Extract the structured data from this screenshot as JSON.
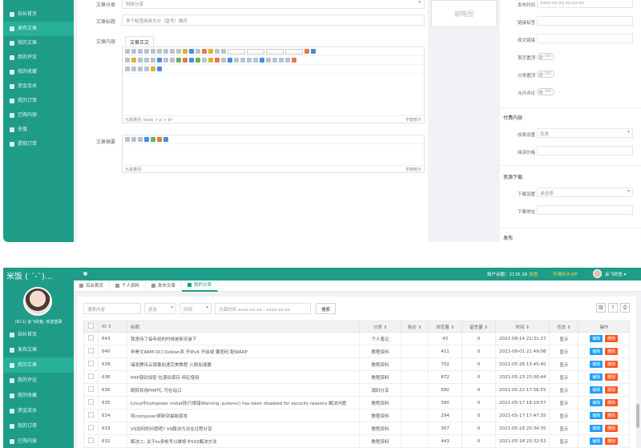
{
  "top": {
    "sidebar": [
      {
        "label": "站长首页",
        "active": false
      },
      {
        "label": "发布文章",
        "active": true
      },
      {
        "label": "我的文章",
        "active": false
      },
      {
        "label": "我的评论",
        "active": false
      },
      {
        "label": "我的收藏",
        "active": false
      },
      {
        "label": "资金流水",
        "active": false
      },
      {
        "label": "我的订单",
        "active": false
      },
      {
        "label": "已购内容",
        "active": false
      },
      {
        "label": "充值",
        "active": false
      },
      {
        "label": "提现订单",
        "active": false
      }
    ],
    "form": {
      "category_label": "文章分类",
      "category_value": "科技分享",
      "title_label": "文章标题",
      "title_value": "多个标签用英文分（逗号）隔开",
      "content_label": "文章内容",
      "tab_label": "文章正文",
      "editor_status_left": "元素路径: body > p > br",
      "editor_status_right": "字数统计",
      "summary_label": "文章摘要",
      "summary_status_left": "元素路径:",
      "summary_status_right": "字数统计"
    },
    "thumb": "缩略图",
    "options": {
      "time_label": "发布时间",
      "time_value": "xxxx-xx-xx xx:xx:xx",
      "tag_label": "链接标签",
      "source_label": "原文链接",
      "top_label": "首页置顶",
      "comment_label": "允许评论",
      "toggles": [
        {
          "label": "首页置顶",
          "value": "OFF"
        },
        {
          "label": "分类置顶",
          "value": "OFF"
        },
        {
          "label": "允许评论",
          "value": "OFF"
        }
      ],
      "section_paid": "付费内容",
      "charge_label": "收费设置",
      "charge_value": "免费",
      "price_label": "阅读价格",
      "section_download": "资源下载",
      "download_label": "下载设置",
      "download_value": "请选择",
      "download_url_label": "下载地址",
      "section_publish": "发布"
    }
  },
  "bottom": {
    "logo": "米饭 ( ´-`)...",
    "balance_text": "账户余额：2135.36",
    "balance_link": "充值",
    "vip_link": "开通永久VIP",
    "username": "会飞的鱼",
    "welcome": "(ID:1) 会飞的鱼, 欢迎登录",
    "sidebar": [
      {
        "label": "站长首页",
        "active": false
      },
      {
        "label": "发布文章",
        "active": false
      },
      {
        "label": "我的文章",
        "active": true
      },
      {
        "label": "我的评论",
        "active": false
      },
      {
        "label": "我的收藏",
        "active": false
      },
      {
        "label": "资金流水",
        "active": false
      },
      {
        "label": "我的订单",
        "active": false
      },
      {
        "label": "已购内容",
        "active": false
      }
    ],
    "tabs": [
      {
        "label": "后台首页",
        "active": false
      },
      {
        "label": "个人资料",
        "active": false
      },
      {
        "label": "发布文章",
        "active": false
      },
      {
        "label": "我的文章",
        "active": true
      }
    ],
    "filters": {
      "search_placeholder": "搜索内容",
      "status": "状态",
      "time": "时间",
      "date_range": "文章时间 xxxx-xx-xx - xxxx-xx-xx",
      "search_button": "搜索"
    },
    "columns": [
      "ID",
      "标题",
      "分类",
      "售价",
      "浏览量",
      "留言量",
      "时间",
      "状态",
      "操作"
    ],
    "rows": [
      {
        "id": "643",
        "title": "我坚持了每年给的时候是新安装下",
        "category": "个人笔记",
        "price": "",
        "views": "43",
        "comments": "0",
        "time": "2021-08-14 21:31:27",
        "status": "显示"
      },
      {
        "id": "640",
        "title": "甲骨文ARM OCI Debian系 开IPv6 开启或 要密码 配WARP",
        "category": "教程资料",
        "price": "",
        "views": "411",
        "comments": "0",
        "time": "2021-08-01 21:49:08",
        "status": "显示"
      },
      {
        "id": "639",
        "title": "储发腾讯云镜像加速完美教程 火箭加速器",
        "category": "教程资料",
        "price": "",
        "views": "702",
        "comments": "0",
        "time": "2021-05-26 13:45:40",
        "status": "显示"
      },
      {
        "id": "638",
        "title": "PHP源码加密 在源码保存 特征使用",
        "category": "教程资料",
        "price": "",
        "views": "872",
        "comments": "0",
        "time": "2021-05-23 23:00:44",
        "status": "显示"
      },
      {
        "id": "636",
        "title": "跳转到用PHP代, 可在站口",
        "category": "源码分享",
        "price": "",
        "views": "580",
        "comments": "0",
        "time": "2021-05-22 17:56:55",
        "status": "显示"
      },
      {
        "id": "635",
        "title": "Linux中composer install执行报错Warning: putenv() has been disabled for security reasons 解决问题",
        "category": "教程资料",
        "price": "",
        "views": "390",
        "comments": "0",
        "time": "2021-05-17 18:19:57",
        "status": "显示"
      },
      {
        "id": "634",
        "title": "将composer更新到最新版本",
        "category": "教程资料",
        "price": "",
        "views": "294",
        "comments": "0",
        "time": "2021-05-17 17:47:35",
        "status": "显示"
      },
      {
        "id": "633",
        "title": "VS如何的问题呢? VS解决方法全过程分享",
        "category": "教程资料",
        "price": "",
        "views": "307",
        "comments": "0",
        "time": "2021-05-16 20:34:35",
        "status": "显示"
      },
      {
        "id": "632",
        "title": "解决二: 关于to多帐号以维修卡502解决方法",
        "category": "教程资料",
        "price": "",
        "views": "443",
        "comments": "0",
        "time": "2021-05-16 23:32:53",
        "status": "显示"
      }
    ],
    "edit_label": "编辑",
    "delete_label": "删除"
  }
}
